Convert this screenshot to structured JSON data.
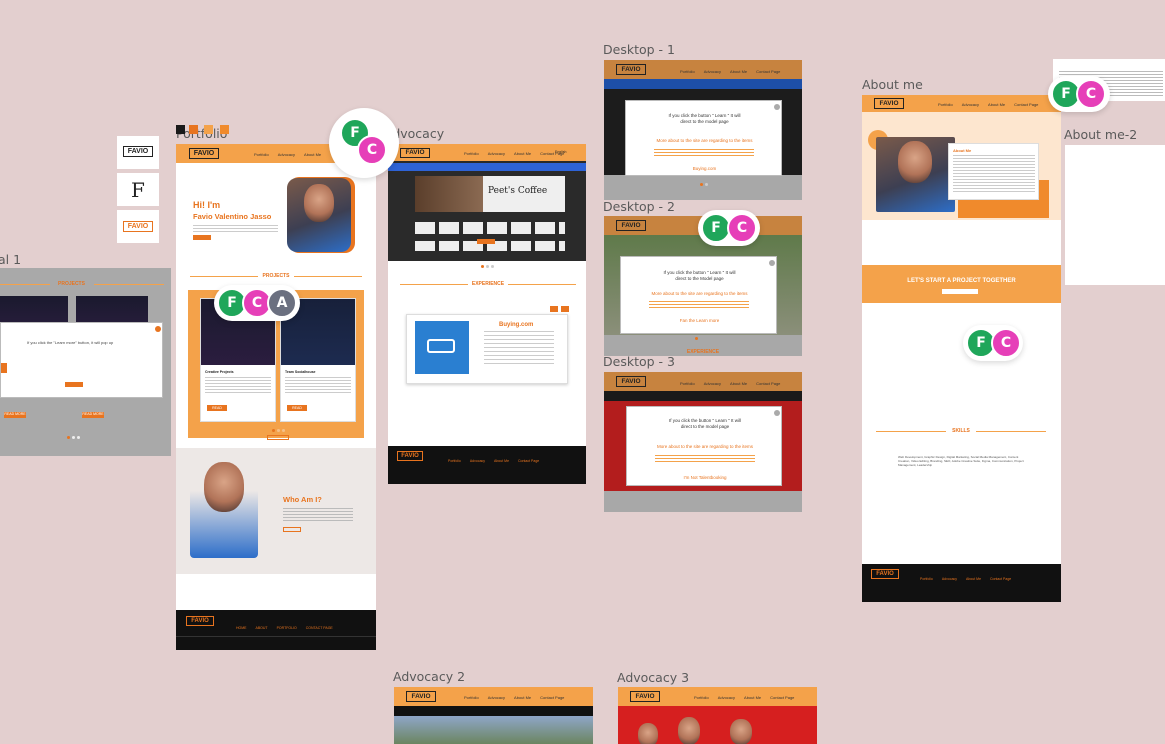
{
  "frames": {
    "portfolio": "Portfolio",
    "advocacy": "Advocacy",
    "desktop1": "Desktop - 1",
    "desktop2": "Desktop - 2",
    "desktop3": "Desktop - 3",
    "about": "About me",
    "about2": "About me-2",
    "advocacy2": "Advocacy 2",
    "advocacy3": "Advocacy 3",
    "left_partial": "al 1"
  },
  "brand": {
    "logo": "FAVIO",
    "accent": "#f4a24a",
    "orange": "#e8741f"
  },
  "swatches": [
    "#1a1a1a",
    "#e8741f",
    "#f4a24a",
    "#f08a2c"
  ],
  "collaborators": {
    "f": "F",
    "c": "C",
    "a": "A"
  },
  "nav": {
    "portfolio": "Portfolio",
    "advocacy": "Advocacy",
    "about": "About Me",
    "contact": "Contact Page",
    "lang": "English"
  },
  "portfolio": {
    "hi": "Hi! I'm",
    "name": "Favio Valentino Jasso",
    "projects": "PROJECTS",
    "whoami": "Who Am I?",
    "p1_title": "Creative Projects",
    "p2_title": "Team Socialhouse",
    "read_more": "READ MORE",
    "footer_links": [
      "HOME",
      "ABOUT",
      "PORTFOLIO",
      "CONTACT PAGE"
    ]
  },
  "advocacy": {
    "experience": "EXPERIENCE",
    "buying": "Buying.com",
    "peets": "Peet's Coffee",
    "footer_links": [
      "Portfolio",
      "Advocacy",
      "About Me",
      "Contact Page"
    ]
  },
  "modal": {
    "line1": "If you click the button \" Learn \" It will",
    "line2": "direct to the model page",
    "line3": "More about to the site are regarding to the items",
    "line4": "Buying.com",
    "d2_line1": "If you click the button \" Learn \" It will",
    "d2_line2": "direct to the Model page",
    "d2_line3": "More about to the site are regarding to the items",
    "d2_line4": "Fan the Learn more",
    "d3_line4": "I'm Not Talentbooking"
  },
  "desktop2": {
    "experience": "EXPERIENCE"
  },
  "about": {
    "about_me": "About Me",
    "cta": "LET'S START A PROJECT TOGETHER",
    "skills": "SKILLS",
    "skills_text": "Web Development, Graphic Design, Digital Marketing, Social Media Management, Content Creation, Video Editing, Branding, SEO, Adobe Creative Suite, Figma, Communication, Project Management, Leadership"
  },
  "left_partial": {
    "projects": "PROJECTS",
    "modal_text": "If you click the \"Learn more\" button, it will pop up",
    "read_more": "READ MORE"
  },
  "side_logos": [
    "FAVIO",
    "F",
    "FAVIO"
  ]
}
